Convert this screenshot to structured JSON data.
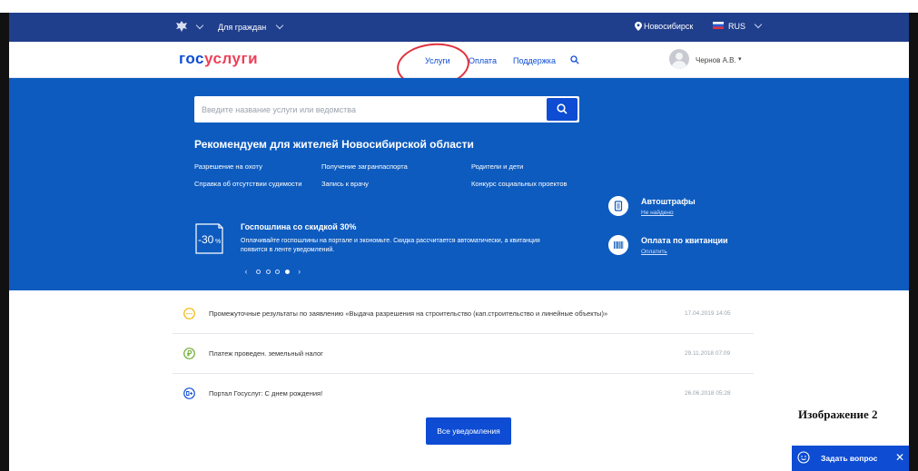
{
  "topbar": {
    "audience": "Для граждан",
    "city": "Новосибирск",
    "language": "RUS",
    "icons": [
      "emblem-icon",
      "location-pin-icon",
      "russia-flag-icon",
      "chevron-down-icon"
    ]
  },
  "navbar": {
    "logo_part1": "гос",
    "logo_part2": "услуги",
    "links": [
      "Услуги",
      "Оплата",
      "Поддержка"
    ],
    "user_name": "Чернов А.В.",
    "user_caret": "▾"
  },
  "colors": {
    "topbar": "#1f3e8c",
    "brand_blue": "#0d4cd3",
    "hero_blue": "#0d5bbf",
    "logo_red": "#ee3f58",
    "annotation_red": "#e0323e"
  },
  "hero": {
    "search_placeholder": "Введите название услуги или ведомства",
    "recommend_title": "Рекомендуем для жителей Новосибирской области",
    "links": [
      "Разрешение на охоту",
      "Получение загранпаспорта",
      "Родители и дети",
      "Справка об отсутствии судимости",
      "Запись к врачу",
      "Конкурс социальных проектов"
    ],
    "promo": {
      "badge": "-30",
      "badge_unit": "%",
      "title": "Госпошлина со скидкой 30%",
      "text": "Оплачивайте госпошлины на портале и экономьте. Скидка рассчитается автоматически, а квитанция появится в ленте уведомлений."
    },
    "pager": {
      "prev": "‹",
      "next": "›",
      "pages": 4,
      "active_index": 3
    },
    "widgets": [
      {
        "title": "Автоштрафы",
        "link": "Не найдено",
        "icon": "fine-receipt-icon"
      },
      {
        "title": "Оплата по квитанции",
        "link": "Оплатить",
        "icon": "barcode-icon"
      }
    ]
  },
  "notifications": [
    {
      "text": "Промежуточные результаты по заявлению «Выдача разрешения на строительство (кап.строительство и линейные объекты)»",
      "date": "17.04.2019 14:05",
      "icon": "in-progress-icon",
      "color": "#f2b600"
    },
    {
      "text": "Платеж проведен. земельный налог",
      "date": "29.11.2018 07:09",
      "icon": "ruble-icon",
      "color": "#6aab2e"
    },
    {
      "text": "Портал Госуслуг: С днем рождения!",
      "date": "26.06.2018 05:28",
      "icon": "birthday-icon",
      "color": "#0d4cd3"
    }
  ],
  "all_notifications_label": "Все уведомления",
  "caption": "Изображение 2",
  "ask": {
    "label": "Задать вопрос",
    "close": "✕"
  }
}
